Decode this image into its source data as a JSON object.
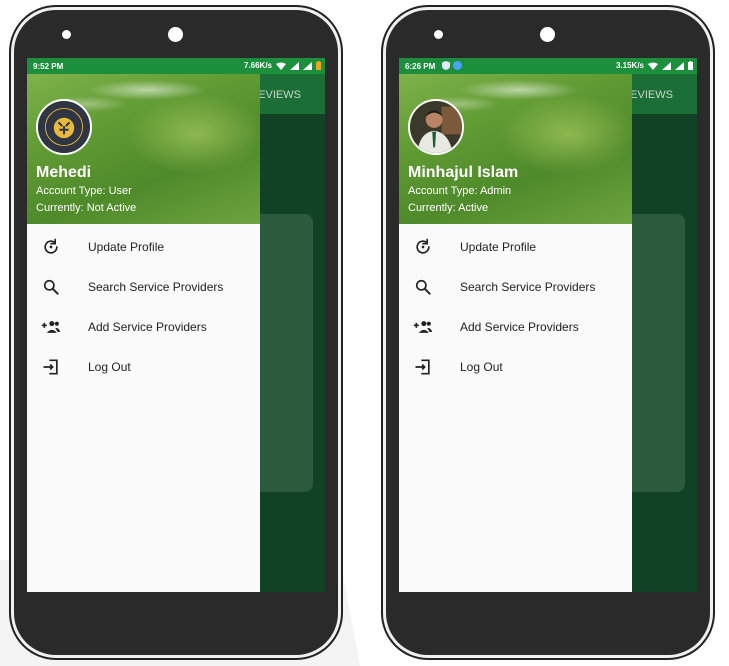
{
  "phones": [
    {
      "status": {
        "time": "9:52 PM",
        "speed": "7.66K/s"
      },
      "appbar": {
        "tab_label": "EVIEWS"
      },
      "user": {
        "name": "Mehedi",
        "account_type": "Account Type: User",
        "status": "Currently: Not Active"
      },
      "menu": [
        {
          "icon": "refresh-icon",
          "label": "Update Profile"
        },
        {
          "icon": "search-icon",
          "label": "Search Service Providers"
        },
        {
          "icon": "group-add-icon",
          "label": "Add Service Providers"
        },
        {
          "icon": "logout-icon",
          "label": "Log Out"
        }
      ]
    },
    {
      "status": {
        "time": "6:26 PM",
        "speed": "3.15K/s"
      },
      "appbar": {
        "tab_label": "EVIEWS"
      },
      "user": {
        "name": "Minhajul Islam",
        "account_type": "Account Type: Admin",
        "status": "Currently: Active"
      },
      "menu": [
        {
          "icon": "refresh-icon",
          "label": "Update Profile"
        },
        {
          "icon": "search-icon",
          "label": "Search Service Providers"
        },
        {
          "icon": "group-add-icon",
          "label": "Add Service Providers"
        },
        {
          "icon": "logout-icon",
          "label": "Log Out"
        }
      ]
    }
  ],
  "colors": {
    "status_bar": "#1b8f3c",
    "app_bar": "#1b6e35",
    "screen_background": "#114225",
    "drawer": "#fafafa"
  }
}
